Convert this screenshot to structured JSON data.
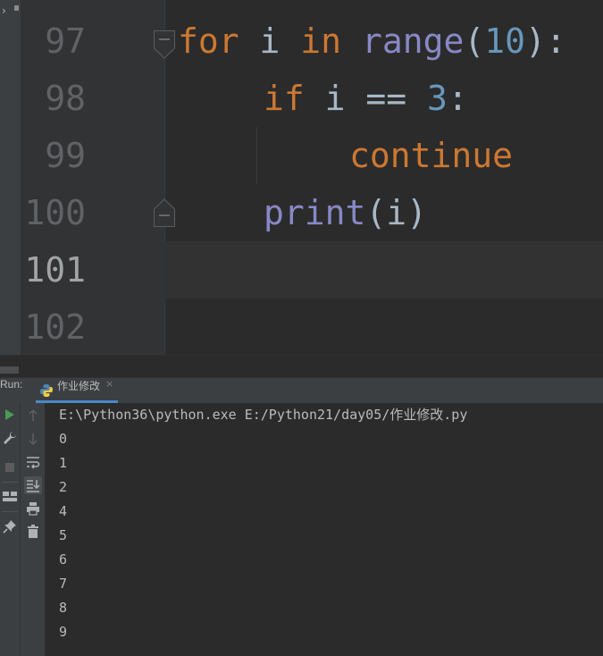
{
  "editor": {
    "line_numbers": [
      "97",
      "98",
      "99",
      "100",
      "101",
      "102"
    ],
    "current_line": "101",
    "code": {
      "line97": {
        "kw_for": "for",
        "var_i": " i ",
        "kw_in": "in",
        "sp": " ",
        "fn_range": "range",
        "open": "(",
        "arg": "10",
        "close": "):"
      },
      "line98": {
        "kw_if": "if",
        "cond": " i == ",
        "val": "3",
        "colon": ":"
      },
      "line99": {
        "kw_continue": "continue"
      },
      "line100": {
        "fn_print": "print",
        "args": "(i)"
      }
    },
    "syntax_colors": {
      "keyword": "#cc7832",
      "builtin": "#8888c6",
      "number": "#6897bb",
      "text": "#a9b7c6"
    }
  },
  "run_panel": {
    "label": "Run:",
    "tab": {
      "title": "作业修改",
      "close": "×",
      "icon": "python-icon"
    },
    "toolbar_left": [
      "play-icon",
      "wrench-icon",
      "stop-icon",
      "layout-icon",
      "pin-icon"
    ],
    "toolbar_right": [
      "arrow-up-icon",
      "arrow-down-icon",
      "soft-wrap-icon",
      "scroll-to-end-icon",
      "print-icon",
      "trash-icon"
    ],
    "command": "E:\\Python36\\python.exe E:/Python21/day05/作业修改.py",
    "output": [
      "0",
      "1",
      "2",
      "4",
      "5",
      "6",
      "7",
      "8",
      "9"
    ],
    "accent_color": "#4a88c7"
  }
}
